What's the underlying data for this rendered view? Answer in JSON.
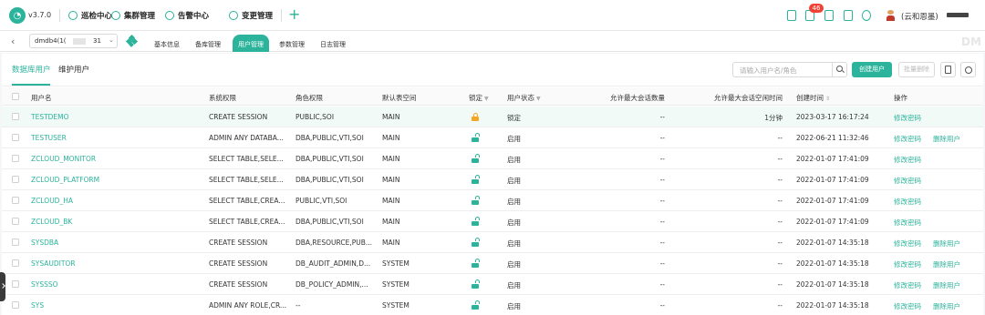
{
  "app": {
    "version": "v3.7.0",
    "nav": [
      {
        "label": "巡检中心",
        "icon": "inspection-icon"
      },
      {
        "label": "集群管理",
        "icon": "cluster-icon"
      },
      {
        "label": "告警中心",
        "icon": "bell-icon"
      },
      {
        "label": "变更管理",
        "icon": "change-icon"
      }
    ],
    "plus_icon": "+",
    "notification_count": "46",
    "user_name": "(云和恩墨)"
  },
  "subbar": {
    "db_name": "dmdb4(1(",
    "db_suffix": "31",
    "tabs": [
      "基本信息",
      "备库管理",
      "用户管理",
      "参数管理",
      "日志管理"
    ],
    "active_tab": "用户管理",
    "watermark": "DM"
  },
  "content": {
    "tabs": [
      "数据库用户",
      "维护用户"
    ],
    "active_tab": "数据库用户",
    "search_placeholder": "请输入用户名/角色",
    "create_label": "创建用户",
    "batch_delete_label": "批量删除"
  },
  "table": {
    "headers": {
      "name": "用户名",
      "sys_priv": "系统权限",
      "role_priv": "角色权限",
      "tablespace": "默认表空间",
      "lock": "锁定",
      "status": "用户状态",
      "max_sessions": "允许最大会话数量",
      "max_idle": "允许最大会话空闲时间",
      "created": "创建时间",
      "actions": "操作"
    },
    "rows": [
      {
        "name": "TESTDEMO",
        "sys_priv": "CREATE SESSION",
        "role_priv": "PUBLIC,SOI",
        "tablespace": "MAIN",
        "locked": true,
        "status": "锁定",
        "max_sessions": "--",
        "max_idle": "1分钟",
        "created": "2023-03-17 16:17:24",
        "edit": "修改密码",
        "delete": ""
      },
      {
        "name": "TESTUSER",
        "sys_priv": "ADMIN ANY DATABA...",
        "role_priv": "DBA,PUBLIC,VTI,SOI",
        "tablespace": "MAIN",
        "locked": false,
        "status": "启用",
        "max_sessions": "--",
        "max_idle": "--",
        "created": "2022-06-21 11:32:46",
        "edit": "修改密码",
        "delete": "删除用户"
      },
      {
        "name": "ZCLOUD_MONITOR",
        "sys_priv": "SELECT TABLE,SELE...",
        "role_priv": "DBA,PUBLIC,VTI,SOI",
        "tablespace": "MAIN",
        "locked": false,
        "status": "启用",
        "max_sessions": "--",
        "max_idle": "--",
        "created": "2022-01-07 17:41:09",
        "edit": "修改密码",
        "delete": ""
      },
      {
        "name": "ZCLOUD_PLATFORM",
        "sys_priv": "SELECT TABLE,SELE...",
        "role_priv": "DBA,PUBLIC,VTI,SOI",
        "tablespace": "MAIN",
        "locked": false,
        "status": "启用",
        "max_sessions": "--",
        "max_idle": "--",
        "created": "2022-01-07 17:41:09",
        "edit": "修改密码",
        "delete": ""
      },
      {
        "name": "ZCLOUD_HA",
        "sys_priv": "SELECT TABLE,CREA...",
        "role_priv": "PUBLIC,VTI,SOI",
        "tablespace": "MAIN",
        "locked": false,
        "status": "启用",
        "max_sessions": "--",
        "max_idle": "--",
        "created": "2022-01-07 17:41:09",
        "edit": "修改密码",
        "delete": ""
      },
      {
        "name": "ZCLOUD_BK",
        "sys_priv": "SELECT TABLE,CREA...",
        "role_priv": "DBA,PUBLIC,VTI,SOI",
        "tablespace": "MAIN",
        "locked": false,
        "status": "启用",
        "max_sessions": "--",
        "max_idle": "--",
        "created": "2022-01-07 17:41:09",
        "edit": "修改密码",
        "delete": ""
      },
      {
        "name": "SYSDBA",
        "sys_priv": "CREATE SESSION",
        "role_priv": "DBA,RESOURCE,PUB...",
        "tablespace": "MAIN",
        "locked": false,
        "status": "启用",
        "max_sessions": "--",
        "max_idle": "--",
        "created": "2022-01-07 14:35:18",
        "edit": "修改密码",
        "delete": "删除用户"
      },
      {
        "name": "SYSAUDITOR",
        "sys_priv": "CREATE SESSION",
        "role_priv": "DB_AUDIT_ADMIN,D...",
        "tablespace": "SYSTEM",
        "locked": false,
        "status": "启用",
        "max_sessions": "--",
        "max_idle": "--",
        "created": "2022-01-07 14:35:18",
        "edit": "修改密码",
        "delete": "删除用户"
      },
      {
        "name": "SYSSSO",
        "sys_priv": "CREATE SESSION",
        "role_priv": "DB_POLICY_ADMIN,...",
        "tablespace": "SYSTEM",
        "locked": false,
        "status": "启用",
        "max_sessions": "--",
        "max_idle": "--",
        "created": "2022-01-07 14:35:18",
        "edit": "修改密码",
        "delete": "删除用户"
      },
      {
        "name": "SYS",
        "sys_priv": "ADMIN ANY ROLE,CR...",
        "role_priv": "--",
        "tablespace": "SYSTEM",
        "locked": false,
        "status": "启用",
        "max_sessions": "--",
        "max_idle": "--",
        "created": "2022-01-07 14:35:18",
        "edit": "修改密码",
        "delete": "删除用户"
      }
    ]
  },
  "colors": {
    "accent": "#2bb39b",
    "warning": "#f5a623",
    "badge": "#f04134"
  }
}
